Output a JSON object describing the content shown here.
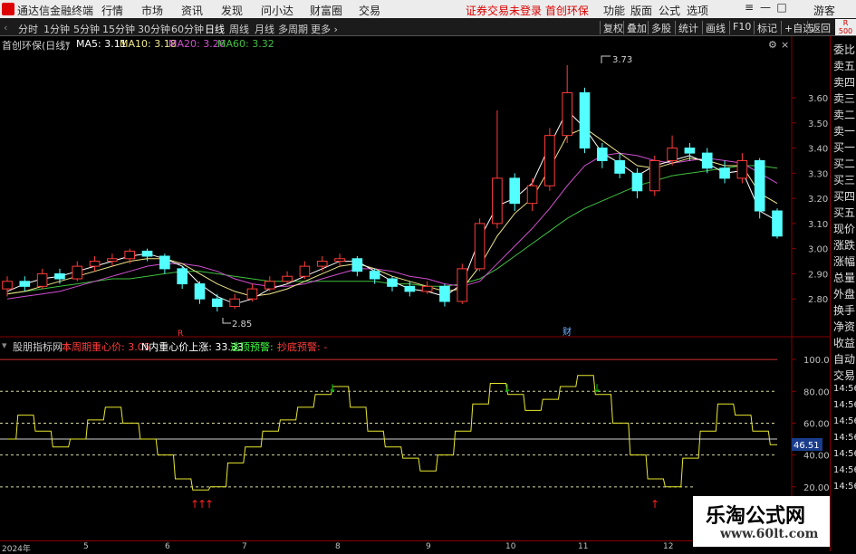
{
  "topbar": {
    "app_title": "通达信金融终端",
    "menu": [
      "行情",
      "市场",
      "资讯",
      "发现",
      "问小达",
      "财富圈",
      "交易"
    ],
    "notice": "证券交易未登录",
    "stock_name": "首创环保",
    "right_menu": [
      "功能",
      "版面",
      "公式",
      "选项"
    ],
    "guest": "游客"
  },
  "periods": [
    "分时",
    "1分钟",
    "5分钟",
    "15分钟",
    "30分钟",
    "60分钟",
    "日线",
    "周线",
    "月线",
    "多周期",
    "更多"
  ],
  "active_period": "日线",
  "toolbar_right": [
    "复权",
    "叠加",
    "多股",
    "统计",
    "画线",
    "F10",
    "标记",
    "+自选",
    "返回"
  ],
  "badge": {
    "l1": "R",
    "l2": "500"
  },
  "main_chart": {
    "header": {
      "title": "首创环保(日线)",
      "ma5": "MA5: 3.11",
      "ma10": "MA10: 3.18",
      "ma20": "MA20: 3.26",
      "ma60": "MA60: 3.32"
    },
    "price_ticks": [
      "3.60",
      "3.50",
      "3.40",
      "3.30",
      "3.20",
      "3.10",
      "3.00",
      "2.90",
      "2.80"
    ],
    "high_label": "3.73",
    "low_label": "2.85",
    "marker_r": "R",
    "marker_cai": "财"
  },
  "sub_chart": {
    "name": "股朋指标网",
    "i1": "本周期重心价: 3.05",
    "i2": "N内重心价上涨: 33.33",
    "i3": "逃顶预警: -",
    "i4": "抄底预警: -",
    "ticks": [
      "100.0",
      "80.00",
      "60.00",
      "40.00",
      "20.00"
    ],
    "current": "46.51"
  },
  "right_panel": {
    "top": [
      "委比",
      "卖五",
      "卖四",
      "卖三",
      "卖二",
      "卖一",
      "买一",
      "买二",
      "买三",
      "买四",
      "买五",
      "现价",
      "涨跌",
      "涨幅",
      "总量",
      "外盘",
      "换手",
      "净资",
      "收益"
    ],
    "auto": [
      "自动",
      "交易"
    ],
    "times": [
      "14:56",
      "14:56",
      "14:56",
      "14:56",
      "14:56",
      "14:56",
      "14:56"
    ]
  },
  "time_axis": [
    "2024年",
    "5",
    "6",
    "7",
    "8",
    "9",
    "10",
    "11",
    "12"
  ],
  "watermark": {
    "l1": "乐淘公式网",
    "l2": "www.60lt.com"
  },
  "colors": {
    "up": "#ff3b3b",
    "down": "#54ffff",
    "ma5": "#ffffff",
    "ma10": "#f0e68c",
    "ma20": "#d050d0",
    "ma60": "#40c040",
    "sub_line": "#e8e830",
    "alert_green": "#00c000",
    "alert_red": "#ff2020"
  },
  "chart_data": {
    "type": "line",
    "series": [
      {
        "name": "MA5",
        "values": [
          2.83,
          2.86,
          2.88,
          2.89,
          2.91,
          2.93,
          2.95,
          2.97,
          2.98,
          2.96,
          2.93,
          2.86,
          2.81,
          2.78,
          2.8,
          2.84,
          2.86,
          2.89,
          2.92,
          2.95,
          2.95,
          2.91,
          2.87,
          2.84,
          2.83,
          2.81,
          2.86,
          3.04,
          3.17,
          3.2,
          3.26,
          3.41,
          3.55,
          3.48,
          3.38,
          3.34,
          3.29,
          3.33,
          3.35,
          3.37,
          3.34,
          3.3,
          3.31,
          3.15,
          3.11
        ]
      },
      {
        "name": "MA10",
        "values": [
          2.82,
          2.83,
          2.85,
          2.87,
          2.89,
          2.91,
          2.93,
          2.95,
          2.96,
          2.96,
          2.94,
          2.9,
          2.86,
          2.83,
          2.81,
          2.82,
          2.84,
          2.87,
          2.9,
          2.93,
          2.94,
          2.92,
          2.89,
          2.87,
          2.85,
          2.83,
          2.84,
          2.93,
          3.05,
          3.14,
          3.2,
          3.32,
          3.45,
          3.48,
          3.43,
          3.38,
          3.33,
          3.32,
          3.34,
          3.36,
          3.35,
          3.33,
          3.33,
          3.22,
          3.18
        ]
      },
      {
        "name": "MA20",
        "values": [
          2.8,
          2.81,
          2.82,
          2.83,
          2.85,
          2.87,
          2.89,
          2.91,
          2.93,
          2.94,
          2.94,
          2.93,
          2.91,
          2.88,
          2.86,
          2.85,
          2.85,
          2.86,
          2.88,
          2.9,
          2.92,
          2.92,
          2.91,
          2.89,
          2.88,
          2.86,
          2.85,
          2.87,
          2.94,
          3.01,
          3.08,
          3.16,
          3.25,
          3.33,
          3.37,
          3.38,
          3.37,
          3.35,
          3.34,
          3.35,
          3.36,
          3.35,
          3.34,
          3.3,
          3.26
        ]
      },
      {
        "name": "MA60",
        "values": [
          2.82,
          2.83,
          2.84,
          2.85,
          2.86,
          2.87,
          2.88,
          2.88,
          2.89,
          2.9,
          2.91,
          2.91,
          2.9,
          2.89,
          2.88,
          2.87,
          2.87,
          2.87,
          2.87,
          2.87,
          2.87,
          2.87,
          2.86,
          2.86,
          2.85,
          2.85,
          2.86,
          2.88,
          2.92,
          2.97,
          3.02,
          3.07,
          3.12,
          3.16,
          3.19,
          3.22,
          3.25,
          3.27,
          3.29,
          3.3,
          3.31,
          3.32,
          3.33,
          3.33,
          3.32
        ]
      },
      {
        "name": "股朋指标网",
        "values": [
          50,
          65,
          55,
          45,
          50,
          62,
          70,
          60,
          50,
          40,
          25,
          18,
          20,
          35,
          45,
          55,
          62,
          70,
          78,
          83,
          70,
          55,
          45,
          38,
          30,
          40,
          55,
          72,
          85,
          78,
          68,
          75,
          83,
          90,
          78,
          60,
          40,
          25,
          20,
          38,
          55,
          72,
          65,
          55,
          46.51
        ]
      }
    ],
    "candles": [
      {
        "o": 2.84,
        "c": 2.87,
        "h": 2.89,
        "l": 2.81
      },
      {
        "o": 2.87,
        "c": 2.85,
        "h": 2.89,
        "l": 2.83
      },
      {
        "o": 2.85,
        "c": 2.9,
        "h": 2.92,
        "l": 2.84
      },
      {
        "o": 2.9,
        "c": 2.88,
        "h": 2.92,
        "l": 2.86
      },
      {
        "o": 2.88,
        "c": 2.93,
        "h": 2.95,
        "l": 2.87
      },
      {
        "o": 2.93,
        "c": 2.95,
        "h": 2.97,
        "l": 2.91
      },
      {
        "o": 2.95,
        "c": 2.96,
        "h": 2.98,
        "l": 2.93
      },
      {
        "o": 2.96,
        "c": 2.99,
        "h": 3.0,
        "l": 2.94
      },
      {
        "o": 2.99,
        "c": 2.97,
        "h": 3.0,
        "l": 2.95
      },
      {
        "o": 2.97,
        "c": 2.92,
        "h": 2.98,
        "l": 2.9
      },
      {
        "o": 2.92,
        "c": 2.86,
        "h": 2.93,
        "l": 2.84
      },
      {
        "o": 2.86,
        "c": 2.8,
        "h": 2.87,
        "l": 2.78
      },
      {
        "o": 2.8,
        "c": 2.77,
        "h": 2.82,
        "l": 2.75
      },
      {
        "o": 2.77,
        "c": 2.8,
        "h": 2.82,
        "l": 2.76
      },
      {
        "o": 2.8,
        "c": 2.84,
        "h": 2.86,
        "l": 2.79
      },
      {
        "o": 2.84,
        "c": 2.87,
        "h": 2.89,
        "l": 2.83
      },
      {
        "o": 2.87,
        "c": 2.89,
        "h": 2.91,
        "l": 2.86
      },
      {
        "o": 2.89,
        "c": 2.93,
        "h": 2.95,
        "l": 2.88
      },
      {
        "o": 2.93,
        "c": 2.95,
        "h": 2.97,
        "l": 2.91
      },
      {
        "o": 2.95,
        "c": 2.96,
        "h": 2.98,
        "l": 2.93
      },
      {
        "o": 2.96,
        "c": 2.91,
        "h": 2.97,
        "l": 2.89
      },
      {
        "o": 2.91,
        "c": 2.88,
        "h": 2.92,
        "l": 2.86
      },
      {
        "o": 2.88,
        "c": 2.85,
        "h": 2.89,
        "l": 2.83
      },
      {
        "o": 2.85,
        "c": 2.83,
        "h": 2.87,
        "l": 2.81
      },
      {
        "o": 2.83,
        "c": 2.85,
        "h": 2.87,
        "l": 2.82
      },
      {
        "o": 2.85,
        "c": 2.79,
        "h": 2.86,
        "l": 2.77
      },
      {
        "o": 2.79,
        "c": 2.92,
        "h": 2.94,
        "l": 2.78
      },
      {
        "o": 2.92,
        "c": 3.1,
        "h": 3.12,
        "l": 2.91
      },
      {
        "o": 3.1,
        "c": 3.28,
        "h": 3.55,
        "l": 3.08
      },
      {
        "o": 3.28,
        "c": 3.18,
        "h": 3.3,
        "l": 3.15
      },
      {
        "o": 3.18,
        "c": 3.25,
        "h": 3.28,
        "l": 3.15
      },
      {
        "o": 3.25,
        "c": 3.45,
        "h": 3.48,
        "l": 3.23
      },
      {
        "o": 3.45,
        "c": 3.62,
        "h": 3.73,
        "l": 3.42
      },
      {
        "o": 3.62,
        "c": 3.4,
        "h": 3.64,
        "l": 3.38
      },
      {
        "o": 3.4,
        "c": 3.35,
        "h": 3.42,
        "l": 3.32
      },
      {
        "o": 3.35,
        "c": 3.3,
        "h": 3.38,
        "l": 3.28
      },
      {
        "o": 3.3,
        "c": 3.23,
        "h": 3.32,
        "l": 3.2
      },
      {
        "o": 3.23,
        "c": 3.35,
        "h": 3.37,
        "l": 3.21
      },
      {
        "o": 3.35,
        "c": 3.4,
        "h": 3.45,
        "l": 3.33
      },
      {
        "o": 3.4,
        "c": 3.38,
        "h": 3.42,
        "l": 3.35
      },
      {
        "o": 3.38,
        "c": 3.32,
        "h": 3.4,
        "l": 3.3
      },
      {
        "o": 3.32,
        "c": 3.28,
        "h": 3.35,
        "l": 3.26
      },
      {
        "o": 3.28,
        "c": 3.35,
        "h": 3.38,
        "l": 3.26
      },
      {
        "o": 3.35,
        "c": 3.15,
        "h": 3.36,
        "l": 3.12
      },
      {
        "o": 3.15,
        "c": 3.05,
        "h": 3.16,
        "l": 3.04
      }
    ],
    "y_range": [
      2.7,
      3.78
    ],
    "sub_range": [
      0,
      108
    ],
    "title": "首创环保(日线)"
  }
}
